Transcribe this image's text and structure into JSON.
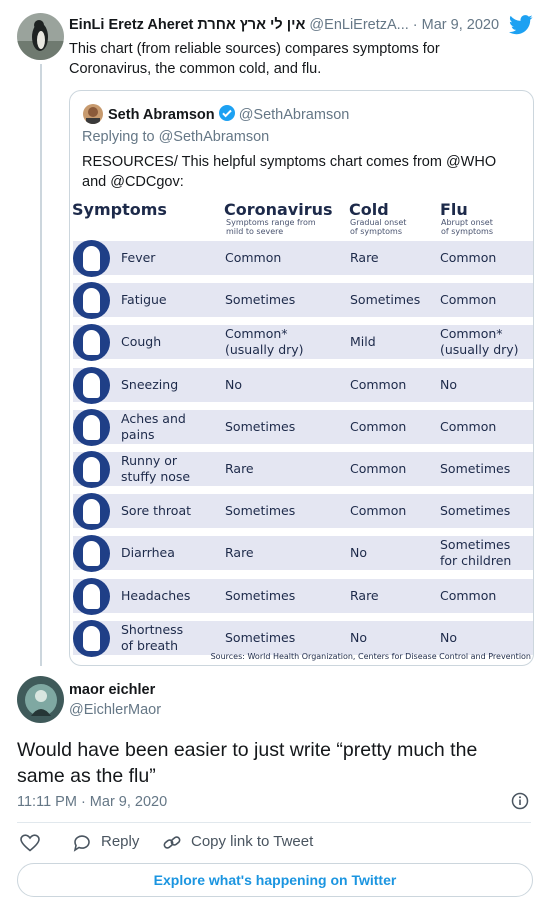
{
  "tweet1": {
    "name": "EinLi Eretz Aheret אין לי ארץ אחרת",
    "handle": "@EnLiEretzA...",
    "date": "· Mar 9, 2020",
    "text_line1": "This chart (from reliable sources) compares symptoms for",
    "text_line2": "Coronavirus, the common cold, and flu."
  },
  "quoted": {
    "name": "Seth Abramson",
    "handle": "@SethAbramson",
    "replying": "Replying to @SethAbramson",
    "text_line1": "RESOURCES/ This helpful symptoms chart comes from @WHO",
    "text_line2": "and @CDCgov:"
  },
  "chart_data": {
    "type": "table",
    "columns": [
      {
        "title": "Symptoms",
        "sub1": "",
        "sub2": ""
      },
      {
        "title": "Coronavirus",
        "sub1": "Symptoms range from",
        "sub2": "mild to severe"
      },
      {
        "title": "Cold",
        "sub1": "Gradual onset",
        "sub2": "of symptoms"
      },
      {
        "title": "Flu",
        "sub1": "Abrupt onset",
        "sub2": "of symptoms"
      }
    ],
    "rows": [
      {
        "symptom": [
          "Fever"
        ],
        "corona": [
          "Common"
        ],
        "cold": [
          "Rare"
        ],
        "flu": [
          "Common"
        ]
      },
      {
        "symptom": [
          "Fatigue"
        ],
        "corona": [
          "Sometimes"
        ],
        "cold": [
          "Sometimes"
        ],
        "flu": [
          "Common"
        ]
      },
      {
        "symptom": [
          "Cough"
        ],
        "corona": [
          "Common*",
          "(usually dry)"
        ],
        "cold": [
          "Mild"
        ],
        "flu": [
          "Common*",
          "(usually dry)"
        ]
      },
      {
        "symptom": [
          "Sneezing"
        ],
        "corona": [
          "No"
        ],
        "cold": [
          "Common"
        ],
        "flu": [
          "No"
        ]
      },
      {
        "symptom": [
          "Aches and",
          "pains"
        ],
        "corona": [
          "Sometimes"
        ],
        "cold": [
          "Common"
        ],
        "flu": [
          "Common"
        ]
      },
      {
        "symptom": [
          "Runny or",
          "stuffy nose"
        ],
        "corona": [
          "Rare"
        ],
        "cold": [
          "Common"
        ],
        "flu": [
          "Sometimes"
        ]
      },
      {
        "symptom": [
          "Sore throat"
        ],
        "corona": [
          "Sometimes"
        ],
        "cold": [
          "Common"
        ],
        "flu": [
          "Sometimes"
        ]
      },
      {
        "symptom": [
          "Diarrhea"
        ],
        "corona": [
          "Rare"
        ],
        "cold": [
          "No"
        ],
        "flu": [
          "Sometimes",
          "for children"
        ]
      },
      {
        "symptom": [
          "Headaches"
        ],
        "corona": [
          "Sometimes"
        ],
        "cold": [
          "Rare"
        ],
        "flu": [
          "Common"
        ]
      },
      {
        "symptom": [
          "Shortness",
          "of breath"
        ],
        "corona": [
          "Sometimes"
        ],
        "cold": [
          "No"
        ],
        "flu": [
          "No"
        ]
      }
    ],
    "source": "Sources: World Health Organization, Centers for Disease Control and Prevention"
  },
  "tweet2": {
    "name": "maor eichler",
    "handle": "@EichlerMaor",
    "text_line1": "Would have been easier to just write “pretty much the",
    "text_line2": "same as the flu”",
    "timestamp": "11:11 PM · Mar 9, 2020"
  },
  "actions": {
    "reply": "Reply",
    "copy_link": "Copy link to Tweet",
    "explore": "Explore what's happening on Twitter"
  },
  "colors": {
    "twitter_blue": "#1da1f2",
    "chart_navy": "#1f3f87",
    "row_band": "#e4e6f2"
  }
}
